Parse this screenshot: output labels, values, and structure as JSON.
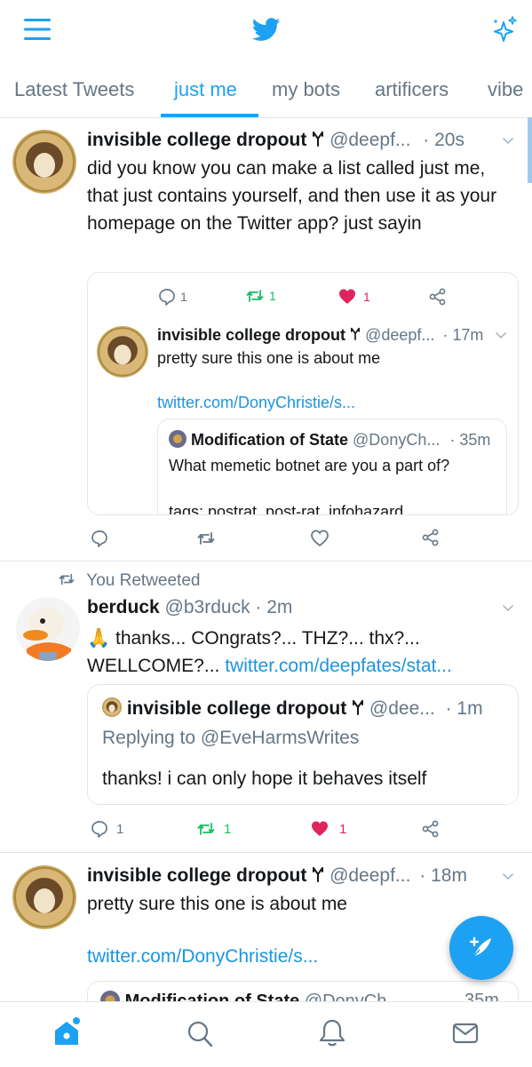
{
  "header": {
    "menu_icon": "hamburger-icon",
    "logo_icon": "twitter-bird-icon",
    "sparkle_icon": "sparkle-icon"
  },
  "tabs": [
    {
      "label": "Latest Tweets"
    },
    {
      "label": "just me"
    },
    {
      "label": "my bots"
    },
    {
      "label": "artificers"
    },
    {
      "label": "vibe"
    }
  ],
  "tweet1": {
    "name": "invisible college dropout",
    "handle": "@deepf...",
    "time": "· 20s",
    "text": "did you know you can make a list called just me, that just contains yourself, and then use it as your homepage on the Twitter app? just sayin",
    "embedded": {
      "reply_count": "1",
      "retweet_count": "1",
      "like_count": "1",
      "name": "invisible college dropout",
      "handle": "@deepf...",
      "time": "· 17m",
      "text": "pretty sure this one is about me",
      "link": "twitter.com/DonyChristie/s...",
      "quote": {
        "name": "Modification of State",
        "handle": "@DonyCh...",
        "time": "· 35m",
        "text": "What memetic botnet are you a part of?",
        "tags": "tags: postrat, post-rat, infohazard"
      }
    }
  },
  "tweet2": {
    "retweet_label": "You Retweeted",
    "name": "berduck",
    "handle": "@b3rduck",
    "time": "· 2m",
    "text_prefix": "🙏  thanks... COngrats?... THZ?... thx?... WELLCOME?...",
    "link": "twitter.com/deepfates/stat...",
    "quote": {
      "name": "invisible college dropout",
      "handle": "@dee...",
      "time": "· 1m",
      "replying": "Replying to",
      "replying_handle": "@EveHarmsWrites",
      "text": "thanks! i can only hope it behaves itself"
    },
    "reply_count": "1",
    "retweet_count": "1",
    "like_count": "1"
  },
  "tweet3": {
    "name": "invisible college dropout",
    "handle": "@deepf...",
    "time": "· 18m",
    "text": "pretty sure this one is about me",
    "link": "twitter.com/DonyChristie/s...",
    "quote_name": "Modification of State",
    "quote_handle": "@DonyCh...",
    "quote_time": "35m"
  },
  "nav": {
    "home_icon": "home-icon",
    "search_icon": "search-icon",
    "bell_icon": "bell-icon",
    "mail_icon": "mail-icon"
  },
  "compose_icon": "compose-tweet-icon",
  "colors": {
    "accent": "#1da1f2",
    "retweet": "#17bf63",
    "like": "#e0245e",
    "muted": "#657786",
    "border": "#e1e8ed"
  }
}
